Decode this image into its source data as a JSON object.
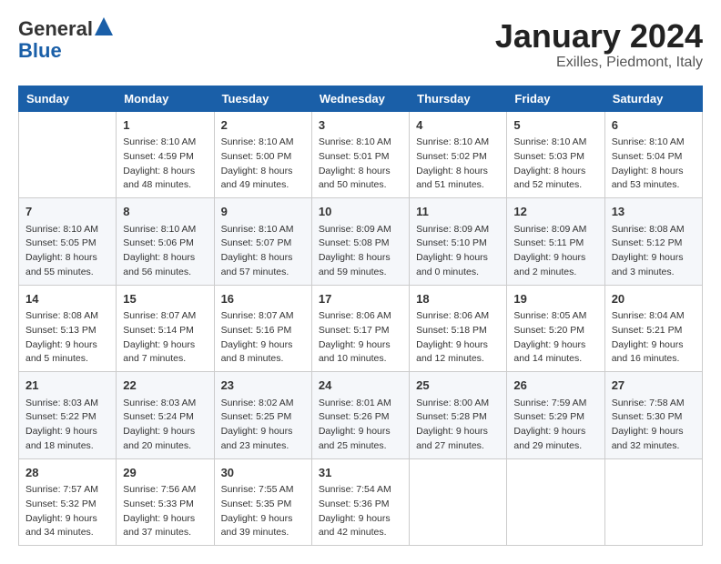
{
  "logo": {
    "general": "General",
    "blue": "Blue"
  },
  "title": "January 2024",
  "subtitle": "Exilles, Piedmont, Italy",
  "days_of_week": [
    "Sunday",
    "Monday",
    "Tuesday",
    "Wednesday",
    "Thursday",
    "Friday",
    "Saturday"
  ],
  "weeks": [
    [
      {
        "day": "",
        "sunrise": "",
        "sunset": "",
        "daylight": ""
      },
      {
        "day": "1",
        "sunrise": "Sunrise: 8:10 AM",
        "sunset": "Sunset: 4:59 PM",
        "daylight": "Daylight: 8 hours and 48 minutes."
      },
      {
        "day": "2",
        "sunrise": "Sunrise: 8:10 AM",
        "sunset": "Sunset: 5:00 PM",
        "daylight": "Daylight: 8 hours and 49 minutes."
      },
      {
        "day": "3",
        "sunrise": "Sunrise: 8:10 AM",
        "sunset": "Sunset: 5:01 PM",
        "daylight": "Daylight: 8 hours and 50 minutes."
      },
      {
        "day": "4",
        "sunrise": "Sunrise: 8:10 AM",
        "sunset": "Sunset: 5:02 PM",
        "daylight": "Daylight: 8 hours and 51 minutes."
      },
      {
        "day": "5",
        "sunrise": "Sunrise: 8:10 AM",
        "sunset": "Sunset: 5:03 PM",
        "daylight": "Daylight: 8 hours and 52 minutes."
      },
      {
        "day": "6",
        "sunrise": "Sunrise: 8:10 AM",
        "sunset": "Sunset: 5:04 PM",
        "daylight": "Daylight: 8 hours and 53 minutes."
      }
    ],
    [
      {
        "day": "7",
        "sunrise": "Sunrise: 8:10 AM",
        "sunset": "Sunset: 5:05 PM",
        "daylight": "Daylight: 8 hours and 55 minutes."
      },
      {
        "day": "8",
        "sunrise": "Sunrise: 8:10 AM",
        "sunset": "Sunset: 5:06 PM",
        "daylight": "Daylight: 8 hours and 56 minutes."
      },
      {
        "day": "9",
        "sunrise": "Sunrise: 8:10 AM",
        "sunset": "Sunset: 5:07 PM",
        "daylight": "Daylight: 8 hours and 57 minutes."
      },
      {
        "day": "10",
        "sunrise": "Sunrise: 8:09 AM",
        "sunset": "Sunset: 5:08 PM",
        "daylight": "Daylight: 8 hours and 59 minutes."
      },
      {
        "day": "11",
        "sunrise": "Sunrise: 8:09 AM",
        "sunset": "Sunset: 5:10 PM",
        "daylight": "Daylight: 9 hours and 0 minutes."
      },
      {
        "day": "12",
        "sunrise": "Sunrise: 8:09 AM",
        "sunset": "Sunset: 5:11 PM",
        "daylight": "Daylight: 9 hours and 2 minutes."
      },
      {
        "day": "13",
        "sunrise": "Sunrise: 8:08 AM",
        "sunset": "Sunset: 5:12 PM",
        "daylight": "Daylight: 9 hours and 3 minutes."
      }
    ],
    [
      {
        "day": "14",
        "sunrise": "Sunrise: 8:08 AM",
        "sunset": "Sunset: 5:13 PM",
        "daylight": "Daylight: 9 hours and 5 minutes."
      },
      {
        "day": "15",
        "sunrise": "Sunrise: 8:07 AM",
        "sunset": "Sunset: 5:14 PM",
        "daylight": "Daylight: 9 hours and 7 minutes."
      },
      {
        "day": "16",
        "sunrise": "Sunrise: 8:07 AM",
        "sunset": "Sunset: 5:16 PM",
        "daylight": "Daylight: 9 hours and 8 minutes."
      },
      {
        "day": "17",
        "sunrise": "Sunrise: 8:06 AM",
        "sunset": "Sunset: 5:17 PM",
        "daylight": "Daylight: 9 hours and 10 minutes."
      },
      {
        "day": "18",
        "sunrise": "Sunrise: 8:06 AM",
        "sunset": "Sunset: 5:18 PM",
        "daylight": "Daylight: 9 hours and 12 minutes."
      },
      {
        "day": "19",
        "sunrise": "Sunrise: 8:05 AM",
        "sunset": "Sunset: 5:20 PM",
        "daylight": "Daylight: 9 hours and 14 minutes."
      },
      {
        "day": "20",
        "sunrise": "Sunrise: 8:04 AM",
        "sunset": "Sunset: 5:21 PM",
        "daylight": "Daylight: 9 hours and 16 minutes."
      }
    ],
    [
      {
        "day": "21",
        "sunrise": "Sunrise: 8:03 AM",
        "sunset": "Sunset: 5:22 PM",
        "daylight": "Daylight: 9 hours and 18 minutes."
      },
      {
        "day": "22",
        "sunrise": "Sunrise: 8:03 AM",
        "sunset": "Sunset: 5:24 PM",
        "daylight": "Daylight: 9 hours and 20 minutes."
      },
      {
        "day": "23",
        "sunrise": "Sunrise: 8:02 AM",
        "sunset": "Sunset: 5:25 PM",
        "daylight": "Daylight: 9 hours and 23 minutes."
      },
      {
        "day": "24",
        "sunrise": "Sunrise: 8:01 AM",
        "sunset": "Sunset: 5:26 PM",
        "daylight": "Daylight: 9 hours and 25 minutes."
      },
      {
        "day": "25",
        "sunrise": "Sunrise: 8:00 AM",
        "sunset": "Sunset: 5:28 PM",
        "daylight": "Daylight: 9 hours and 27 minutes."
      },
      {
        "day": "26",
        "sunrise": "Sunrise: 7:59 AM",
        "sunset": "Sunset: 5:29 PM",
        "daylight": "Daylight: 9 hours and 29 minutes."
      },
      {
        "day": "27",
        "sunrise": "Sunrise: 7:58 AM",
        "sunset": "Sunset: 5:30 PM",
        "daylight": "Daylight: 9 hours and 32 minutes."
      }
    ],
    [
      {
        "day": "28",
        "sunrise": "Sunrise: 7:57 AM",
        "sunset": "Sunset: 5:32 PM",
        "daylight": "Daylight: 9 hours and 34 minutes."
      },
      {
        "day": "29",
        "sunrise": "Sunrise: 7:56 AM",
        "sunset": "Sunset: 5:33 PM",
        "daylight": "Daylight: 9 hours and 37 minutes."
      },
      {
        "day": "30",
        "sunrise": "Sunrise: 7:55 AM",
        "sunset": "Sunset: 5:35 PM",
        "daylight": "Daylight: 9 hours and 39 minutes."
      },
      {
        "day": "31",
        "sunrise": "Sunrise: 7:54 AM",
        "sunset": "Sunset: 5:36 PM",
        "daylight": "Daylight: 9 hours and 42 minutes."
      },
      {
        "day": "",
        "sunrise": "",
        "sunset": "",
        "daylight": ""
      },
      {
        "day": "",
        "sunrise": "",
        "sunset": "",
        "daylight": ""
      },
      {
        "day": "",
        "sunrise": "",
        "sunset": "",
        "daylight": ""
      }
    ]
  ]
}
